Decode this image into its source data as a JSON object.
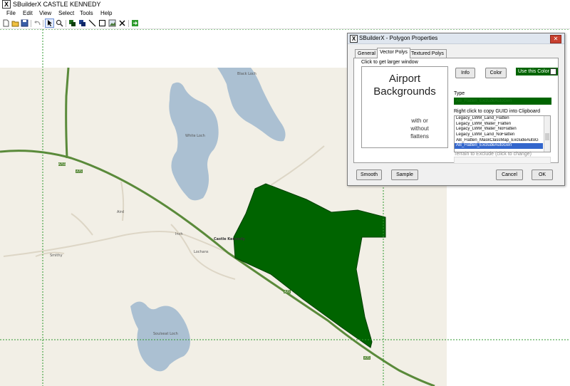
{
  "window": {
    "app_icon": "X",
    "title": "SBuilderX  CASTLE KENNEDY"
  },
  "menu": [
    "File",
    "Edit",
    "View",
    "Select",
    "Tools",
    "Help"
  ],
  "toolbar": {
    "icons": [
      "new-file-icon",
      "open-folder-icon",
      "save-icon",
      "undo-icon",
      "pointer-icon",
      "zoom-icon",
      "layers-icon",
      "layers-alt-icon",
      "line-icon",
      "rectangle-icon",
      "image-icon",
      "delete-icon",
      "run-icon"
    ]
  },
  "map": {
    "labels": {
      "black_loch": "Black\nLoch",
      "white_loch": "White\nLoch",
      "soulseat_loch": "Soulseat\nLoch",
      "castle_kennedy": "Castle\nKennedy",
      "road_a75": "A75",
      "road_a751": "A751",
      "airds": "Aird",
      "lochans": "Lochans",
      "inch": "Inch",
      "smithy": "Smithy"
    },
    "colors": {
      "land": "#f2efe6",
      "water": "#abc0d2",
      "road": "#5a8a3a",
      "polygon": "#006400",
      "guide": "#2f9a2f"
    }
  },
  "dialog": {
    "icon": "X",
    "title": "SBuilderX - Polygon Properties",
    "close_label": "✕",
    "tabs": [
      "General",
      "Vector Polys",
      "Textured Polys"
    ],
    "active_tab": "Vector Polys",
    "preview_hint": "Click to get larger window",
    "preview_title": "Airport\nBackgrounds",
    "preview_sub": "with or\nwithout\nflattens",
    "info_label": "Info",
    "color_label": "Color",
    "use_color_label": "Use this Color",
    "type_label": "Type",
    "type_value": "AB_Flatten_ExcludeAutoGen",
    "guid_hint": "Right click to copy GUID into Clipboard",
    "list_items": [
      "Legacy_LWM_Land_Flatten",
      "Legacy_LWM_Water_Flatten",
      "Legacy_LWM_Water_NoFlatten",
      "Legacy_LWM_Land_NoFlatten",
      "AB_Flatten_MaskClassMap_ExcludeAutoG",
      "AB_Flatten_ExcludeAutoGen"
    ],
    "selected_index": 5,
    "terrain_label": "Terrain to Exclude (click to change)",
    "smooth_label": "Smooth",
    "sample_label": "Sample",
    "cancel_label": "Cancel",
    "ok_label": "OK"
  }
}
